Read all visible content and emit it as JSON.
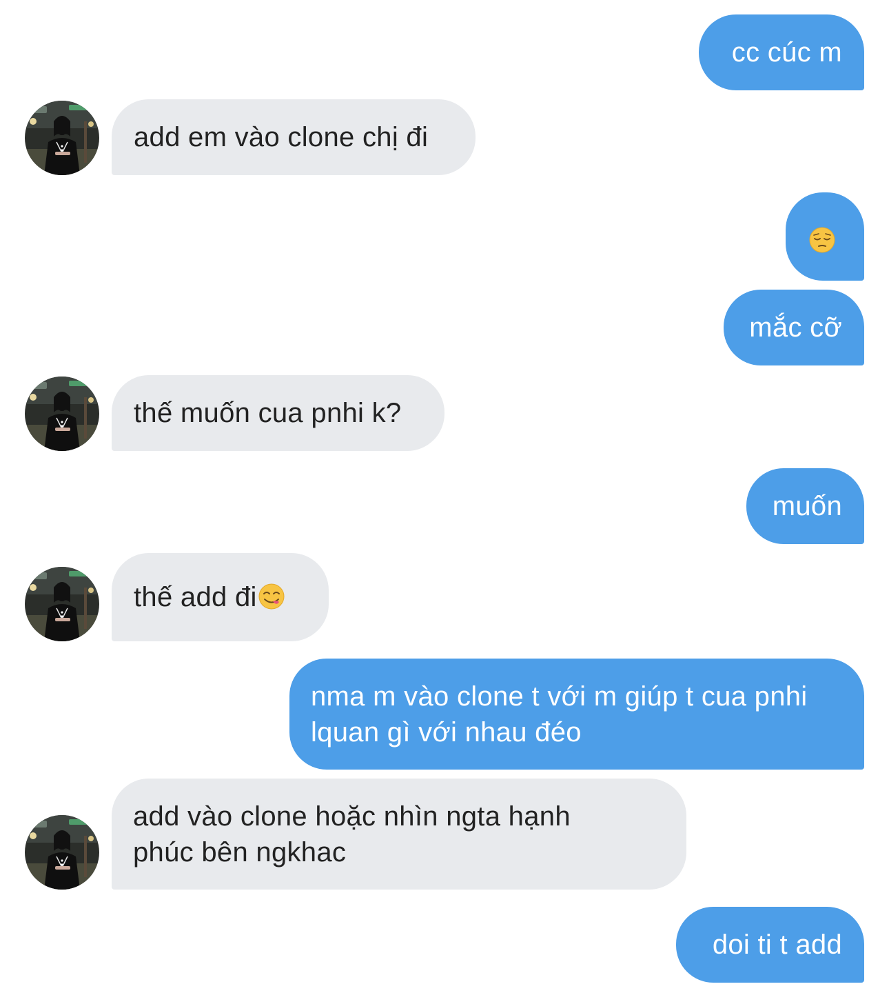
{
  "conversation": {
    "messages": [
      {
        "direction": "outgoing",
        "text": "cc cúc m"
      },
      {
        "direction": "incoming",
        "text": "add em vào clone chị đi"
      },
      {
        "direction": "outgoing",
        "emoji": "pensive-face"
      },
      {
        "direction": "outgoing",
        "text": "mắc cỡ"
      },
      {
        "direction": "incoming",
        "text": "thế muốn cua pnhi k?"
      },
      {
        "direction": "outgoing",
        "text": "muốn"
      },
      {
        "direction": "incoming",
        "text": "thế add đi",
        "emoji": "face-savoring-food"
      },
      {
        "direction": "outgoing",
        "text": "nma m vào clone t với m giúp t cua pnhi lquan gì với nhau đéo"
      },
      {
        "direction": "incoming",
        "text": "add vào clone hoặc nhìn ngta hạnh phúc bên ngkhac"
      },
      {
        "direction": "outgoing",
        "text": "doi ti t add"
      }
    ]
  },
  "colors": {
    "outgoing_bubble": "#4d9ee8",
    "incoming_bubble": "#e8eaed",
    "outgoing_text": "#ffffff",
    "incoming_text": "#222222",
    "background": "#ffffff"
  }
}
